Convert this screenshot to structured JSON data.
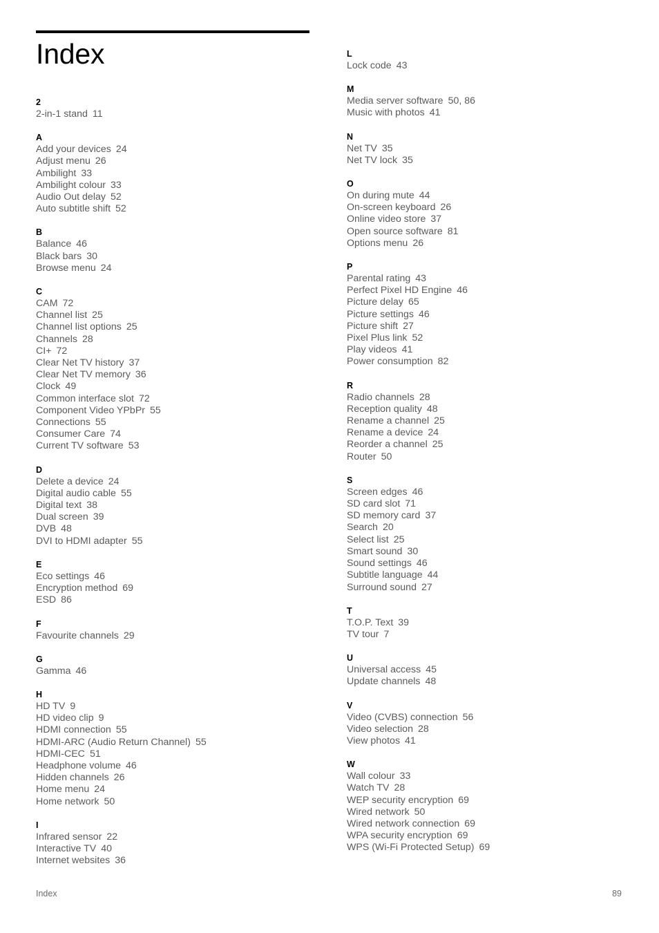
{
  "page_title": "Index",
  "footer": {
    "label": "Index",
    "page_number": "89"
  },
  "columns": [
    {
      "name": "left",
      "sections": [
        {
          "letter": "2",
          "entries": [
            {
              "term": "2-in-1 stand",
              "pages": "11"
            }
          ]
        },
        {
          "letter": "A",
          "entries": [
            {
              "term": "Add your devices",
              "pages": "24"
            },
            {
              "term": "Adjust menu",
              "pages": "26"
            },
            {
              "term": "Ambilight",
              "pages": "33"
            },
            {
              "term": "Ambilight colour",
              "pages": "33"
            },
            {
              "term": "Audio Out delay",
              "pages": "52"
            },
            {
              "term": "Auto subtitle shift",
              "pages": "52"
            }
          ]
        },
        {
          "letter": "B",
          "entries": [
            {
              "term": "Balance",
              "pages": "46"
            },
            {
              "term": "Black bars",
              "pages": "30"
            },
            {
              "term": "Browse menu",
              "pages": "24"
            }
          ]
        },
        {
          "letter": "C",
          "entries": [
            {
              "term": "CAM",
              "pages": "72"
            },
            {
              "term": "Channel list",
              "pages": "25"
            },
            {
              "term": "Channel list options",
              "pages": "25"
            },
            {
              "term": "Channels",
              "pages": "28"
            },
            {
              "term": "CI+",
              "pages": "72"
            },
            {
              "term": "Clear Net TV history",
              "pages": "37"
            },
            {
              "term": "Clear Net TV memory",
              "pages": "36"
            },
            {
              "term": "Clock",
              "pages": "49"
            },
            {
              "term": "Common interface slot",
              "pages": "72"
            },
            {
              "term": "Component Video YPbPr",
              "pages": "55"
            },
            {
              "term": "Connections",
              "pages": "55"
            },
            {
              "term": "Consumer Care",
              "pages": "74"
            },
            {
              "term": "Current TV software",
              "pages": "53"
            }
          ]
        },
        {
          "letter": "D",
          "entries": [
            {
              "term": "Delete a device",
              "pages": "24"
            },
            {
              "term": "Digital audio cable",
              "pages": "55"
            },
            {
              "term": "Digital text",
              "pages": "38"
            },
            {
              "term": "Dual screen",
              "pages": "39"
            },
            {
              "term": "DVB",
              "pages": "48"
            },
            {
              "term": "DVI to HDMI adapter",
              "pages": "55"
            }
          ]
        },
        {
          "letter": "E",
          "entries": [
            {
              "term": "Eco settings",
              "pages": "46"
            },
            {
              "term": "Encryption method",
              "pages": "69"
            },
            {
              "term": "ESD",
              "pages": "86"
            }
          ]
        },
        {
          "letter": "F",
          "entries": [
            {
              "term": "Favourite channels",
              "pages": "29"
            }
          ]
        },
        {
          "letter": "G",
          "entries": [
            {
              "term": "Gamma",
              "pages": "46"
            }
          ]
        },
        {
          "letter": "H",
          "entries": [
            {
              "term": "HD TV",
              "pages": "9"
            },
            {
              "term": "HD video clip",
              "pages": "9"
            },
            {
              "term": "HDMI connection",
              "pages": "55"
            },
            {
              "term": "HDMI-ARC (Audio Return Channel)",
              "pages": "55"
            },
            {
              "term": "HDMI-CEC",
              "pages": "51"
            },
            {
              "term": "Headphone volume",
              "pages": "46"
            },
            {
              "term": "Hidden channels",
              "pages": "26"
            },
            {
              "term": "Home menu",
              "pages": "24"
            },
            {
              "term": "Home network",
              "pages": "50"
            }
          ]
        },
        {
          "letter": "I",
          "entries": [
            {
              "term": "Infrared sensor",
              "pages": "22"
            },
            {
              "term": "Interactive TV",
              "pages": "40"
            },
            {
              "term": "Internet websites",
              "pages": "36"
            }
          ]
        }
      ]
    },
    {
      "name": "right",
      "sections": [
        {
          "letter": "L",
          "entries": [
            {
              "term": "Lock code",
              "pages": "43"
            }
          ]
        },
        {
          "letter": "M",
          "entries": [
            {
              "term": "Media server software",
              "pages": "50, 86"
            },
            {
              "term": "Music with photos",
              "pages": "41"
            }
          ]
        },
        {
          "letter": "N",
          "entries": [
            {
              "term": "Net TV",
              "pages": "35"
            },
            {
              "term": "Net TV lock",
              "pages": "35"
            }
          ]
        },
        {
          "letter": "O",
          "entries": [
            {
              "term": "On during mute",
              "pages": "44"
            },
            {
              "term": "On-screen keyboard",
              "pages": "26"
            },
            {
              "term": "Online video store",
              "pages": "37"
            },
            {
              "term": "Open source software",
              "pages": "81"
            },
            {
              "term": "Options menu",
              "pages": "26"
            }
          ]
        },
        {
          "letter": "P",
          "entries": [
            {
              "term": "Parental rating",
              "pages": "43"
            },
            {
              "term": "Perfect Pixel HD Engine",
              "pages": "46"
            },
            {
              "term": "Picture delay",
              "pages": "65"
            },
            {
              "term": "Picture settings",
              "pages": "46"
            },
            {
              "term": "Picture shift",
              "pages": "27"
            },
            {
              "term": "Pixel Plus link",
              "pages": "52"
            },
            {
              "term": "Play videos",
              "pages": "41"
            },
            {
              "term": "Power consumption",
              "pages": "82"
            }
          ]
        },
        {
          "letter": "R",
          "entries": [
            {
              "term": "Radio channels",
              "pages": "28"
            },
            {
              "term": "Reception quality",
              "pages": "48"
            },
            {
              "term": "Rename a channel",
              "pages": "25"
            },
            {
              "term": "Rename a device",
              "pages": "24"
            },
            {
              "term": "Reorder a channel",
              "pages": "25"
            },
            {
              "term": "Router",
              "pages": "50"
            }
          ]
        },
        {
          "letter": "S",
          "entries": [
            {
              "term": "Screen edges",
              "pages": "46"
            },
            {
              "term": "SD card slot",
              "pages": "71"
            },
            {
              "term": "SD memory card",
              "pages": "37"
            },
            {
              "term": "Search",
              "pages": "20"
            },
            {
              "term": "Select list",
              "pages": "25"
            },
            {
              "term": "Smart sound",
              "pages": "30"
            },
            {
              "term": "Sound settings",
              "pages": "46"
            },
            {
              "term": "Subtitle language",
              "pages": "44"
            },
            {
              "term": "Surround sound",
              "pages": "27"
            }
          ]
        },
        {
          "letter": "T",
          "entries": [
            {
              "term": "T.O.P. Text",
              "pages": "39"
            },
            {
              "term": "TV tour",
              "pages": "7"
            }
          ]
        },
        {
          "letter": "U",
          "entries": [
            {
              "term": "Universal access",
              "pages": "45"
            },
            {
              "term": "Update channels",
              "pages": "48"
            }
          ]
        },
        {
          "letter": "V",
          "entries": [
            {
              "term": "Video (CVBS) connection",
              "pages": "56"
            },
            {
              "term": "Video selection",
              "pages": "28"
            },
            {
              "term": "View photos",
              "pages": "41"
            }
          ]
        },
        {
          "letter": "W",
          "entries": [
            {
              "term": "Wall colour",
              "pages": "33"
            },
            {
              "term": "Watch TV",
              "pages": "28"
            },
            {
              "term": "WEP security encryption",
              "pages": "69"
            },
            {
              "term": "Wired network",
              "pages": "50"
            },
            {
              "term": "Wired network connection",
              "pages": "69"
            },
            {
              "term": "WPA security encryption",
              "pages": "69"
            },
            {
              "term": "WPS (Wi-Fi Protected Setup)",
              "pages": "69"
            }
          ]
        }
      ]
    }
  ]
}
